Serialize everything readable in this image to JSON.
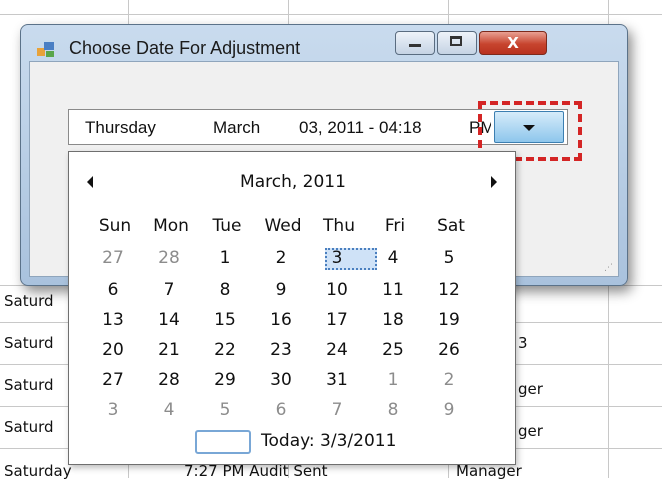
{
  "background": {
    "rows": [
      {
        "day": "Saturd",
        "mid": "",
        "right": "3"
      },
      {
        "day": "Saturd",
        "mid": "",
        "right": "3"
      },
      {
        "day": "Saturd",
        "mid": "",
        "right": "ger"
      },
      {
        "day": "Saturd",
        "mid": "",
        "right": "ger"
      },
      {
        "day": "Saturday",
        "mid": "7:27 PM   Audit Sent",
        "right": "Manager"
      }
    ]
  },
  "dialog": {
    "title": "Choose Date For Adjustment",
    "close_glyph": "X"
  },
  "date_picker": {
    "weekday": "Thursday",
    "month": "March",
    "date_time": "03, 2011 - 04:18",
    "ampm_partial": "PM"
  },
  "calendar": {
    "title": "March, 2011",
    "weekdays": [
      "Sun",
      "Mon",
      "Tue",
      "Wed",
      "Thu",
      "Fri",
      "Sat"
    ],
    "weeks": [
      [
        {
          "d": "27",
          "o": true
        },
        {
          "d": "28",
          "o": true
        },
        {
          "d": "1"
        },
        {
          "d": "2"
        },
        {
          "d": "3",
          "sel": true
        },
        {
          "d": "4"
        },
        {
          "d": "5"
        }
      ],
      [
        {
          "d": "6"
        },
        {
          "d": "7"
        },
        {
          "d": "8"
        },
        {
          "d": "9"
        },
        {
          "d": "10"
        },
        {
          "d": "11"
        },
        {
          "d": "12"
        }
      ],
      [
        {
          "d": "13"
        },
        {
          "d": "14"
        },
        {
          "d": "15"
        },
        {
          "d": "16"
        },
        {
          "d": "17"
        },
        {
          "d": "18"
        },
        {
          "d": "19"
        }
      ],
      [
        {
          "d": "20"
        },
        {
          "d": "21"
        },
        {
          "d": "22"
        },
        {
          "d": "23"
        },
        {
          "d": "24"
        },
        {
          "d": "25"
        },
        {
          "d": "26"
        }
      ],
      [
        {
          "d": "27"
        },
        {
          "d": "28"
        },
        {
          "d": "29"
        },
        {
          "d": "30"
        },
        {
          "d": "31"
        },
        {
          "d": "1",
          "o": true
        },
        {
          "d": "2",
          "o": true
        }
      ],
      [
        {
          "d": "3",
          "o": true
        },
        {
          "d": "4",
          "o": true
        },
        {
          "d": "5",
          "o": true
        },
        {
          "d": "6",
          "o": true
        },
        {
          "d": "7",
          "o": true
        },
        {
          "d": "8",
          "o": true
        },
        {
          "d": "9",
          "o": true
        }
      ]
    ],
    "today_label": "Today: 3/3/2011"
  },
  "colors": {
    "highlight": "#d42525",
    "selection": "#cfe2f7",
    "other_month": "#8c8c8c"
  }
}
